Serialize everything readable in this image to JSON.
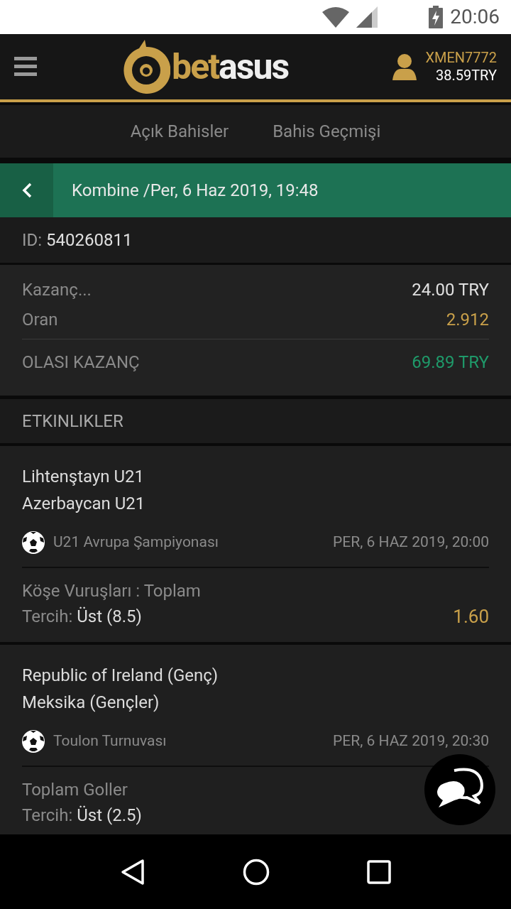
{
  "status_bar": {
    "time": "20:06"
  },
  "header": {
    "logo": {
      "part1": "bet",
      "part2": "asus"
    },
    "username": "XMEN7772",
    "balance": "38.59TRY"
  },
  "tabs": [
    {
      "label": "Açık Bahisler",
      "selected": false
    },
    {
      "label": "Bahis Geçmişi",
      "selected": false
    }
  ],
  "bet_header": {
    "title": "Kombine /Per, 6 Haz 2019, 19:48"
  },
  "bet_id": {
    "label": "ID:",
    "value": "540260811"
  },
  "summary": [
    {
      "label": "Kazanç...",
      "value": "24.00 TRY",
      "kind": "plain"
    },
    {
      "label": "Oran",
      "value": "2.912",
      "kind": "odds"
    },
    {
      "label": "OLASI KAZANÇ",
      "value": "69.89 TRY",
      "kind": "win"
    }
  ],
  "events_heading": "ETKINLIKLER",
  "events": [
    {
      "team1": "Lihtenştayn U21",
      "team2": "Azerbaycan U21",
      "league": "U21 Avrupa Şampiyonası",
      "date": "PER, 6 HAZ 2019, 20:00",
      "market": "Köşe Vuruşları : Toplam",
      "pick_label": "Tercih:",
      "pick": "Üst (8.5)",
      "odds": "1.60"
    },
    {
      "team1": "Republic of Ireland (Genç)",
      "team2": "Meksika (Gençler)",
      "league": "Toulon Turnuvası",
      "date": "PER, 6 HAZ 2019, 20:30",
      "market": "Toplam Goller",
      "pick_label": "Tercih:",
      "pick": "Üst (2.5)"
    }
  ]
}
